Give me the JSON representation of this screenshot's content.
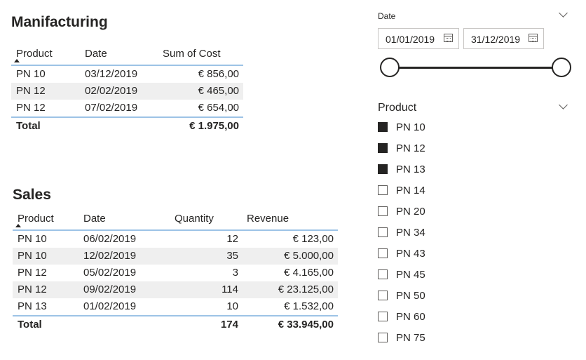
{
  "manufacturing": {
    "title": "Manifacturing",
    "columns": [
      "Product",
      "Date",
      "Sum of Cost"
    ],
    "rows": [
      [
        "PN 10",
        "03/12/2019",
        "€ 856,00"
      ],
      [
        "PN 12",
        "02/02/2019",
        "€ 465,00"
      ],
      [
        "PN 12",
        "07/02/2019",
        "€ 654,00"
      ]
    ],
    "total": {
      "label": "Total",
      "cost": "€ 1.975,00"
    },
    "sort_column": "Product",
    "sort_direction": "ascending"
  },
  "sales": {
    "title": "Sales",
    "columns": [
      "Product",
      "Date",
      "Quantity",
      "Revenue"
    ],
    "rows": [
      [
        "PN 10",
        "06/02/2019",
        "12",
        "€ 123,00"
      ],
      [
        "PN 10",
        "12/02/2019",
        "35",
        "€ 5.000,00"
      ],
      [
        "PN 12",
        "05/02/2019",
        "3",
        "€ 4.165,00"
      ],
      [
        "PN 12",
        "09/02/2019",
        "114",
        "€ 23.125,00"
      ],
      [
        "PN 13",
        "01/02/2019",
        "10",
        "€ 1.532,00"
      ]
    ],
    "total": {
      "label": "Total",
      "quantity": "174",
      "revenue": "€ 33.945,00"
    },
    "sort_column": "Product",
    "sort_direction": "ascending"
  },
  "date_slicer": {
    "title": "Date",
    "start": "01/01/2019",
    "end": "31/12/2019",
    "range_start_fraction": 0,
    "range_end_fraction": 1
  },
  "product_slicer": {
    "title": "Product",
    "items": [
      {
        "label": "PN 10",
        "checked": true
      },
      {
        "label": "PN 12",
        "checked": true
      },
      {
        "label": "PN 13",
        "checked": true
      },
      {
        "label": "PN 14",
        "checked": false
      },
      {
        "label": "PN 20",
        "checked": false
      },
      {
        "label": "PN 34",
        "checked": false
      },
      {
        "label": "PN 43",
        "checked": false
      },
      {
        "label": "PN 45",
        "checked": false
      },
      {
        "label": "PN 50",
        "checked": false
      },
      {
        "label": "PN 60",
        "checked": false
      },
      {
        "label": "PN 75",
        "checked": false
      }
    ]
  },
  "colors": {
    "header_rule": "#9dc3e6",
    "alt_row": "#efefef",
    "text": "#252423",
    "checked": "#252423"
  }
}
